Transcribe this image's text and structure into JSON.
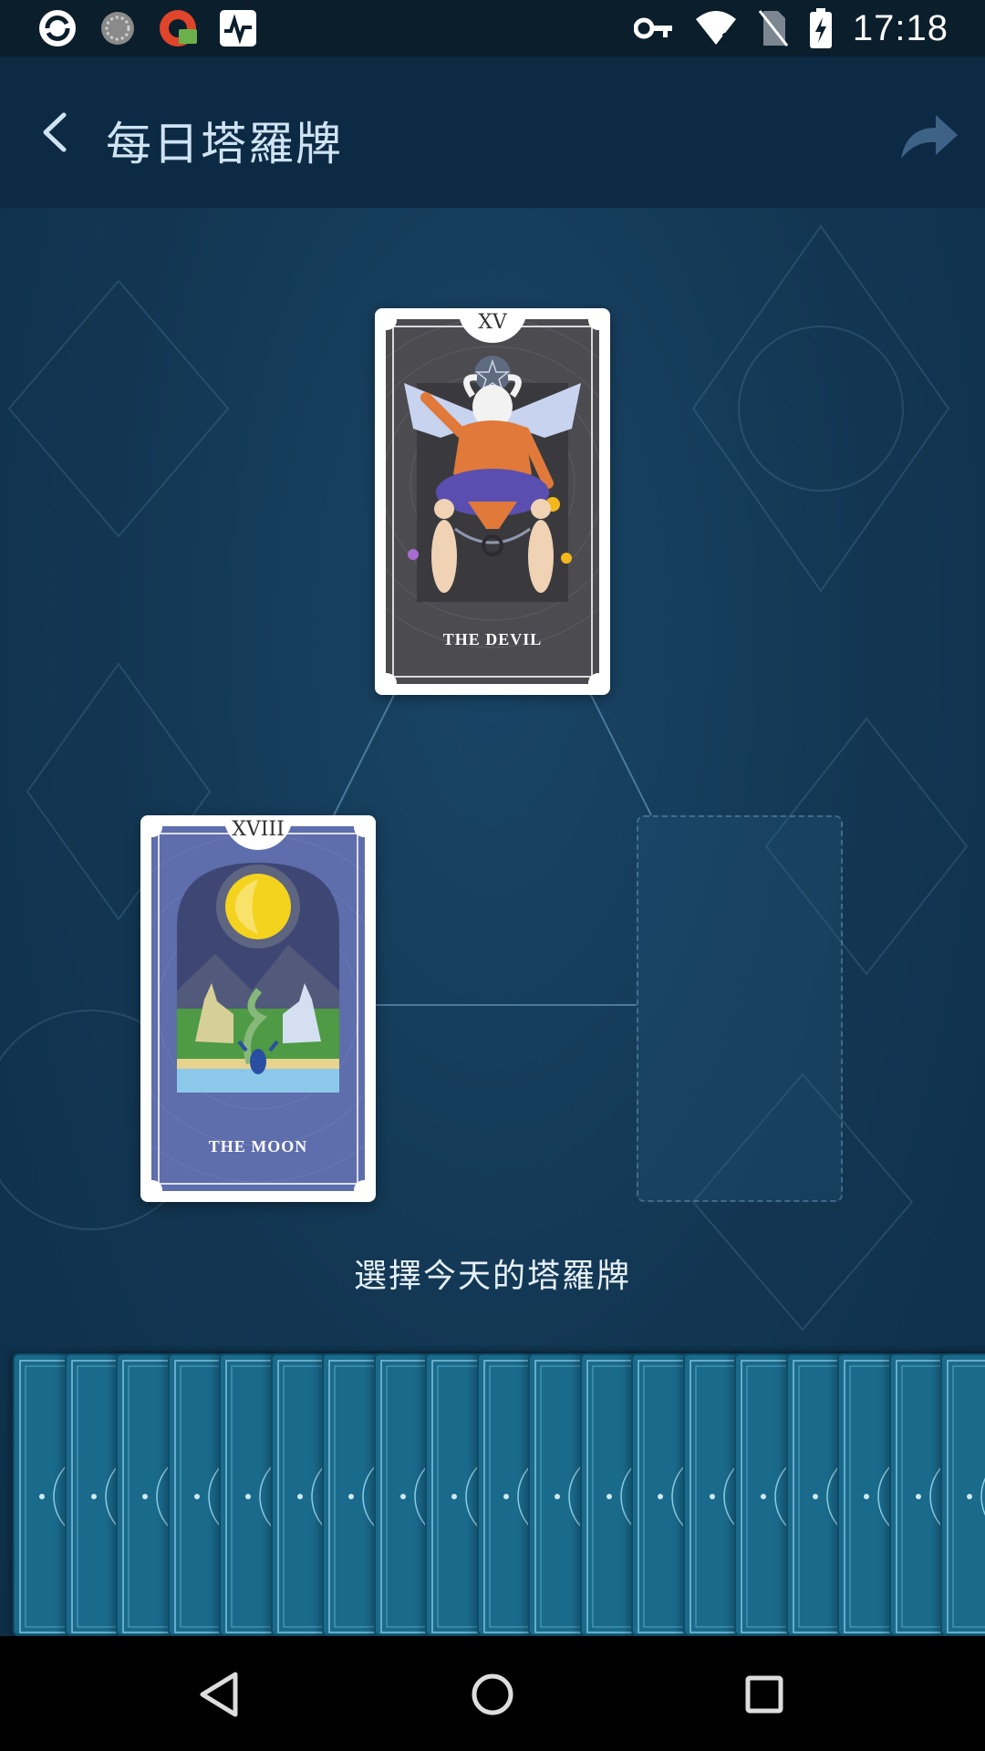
{
  "status_bar": {
    "time": "17:18",
    "left_icons": [
      "sync-app-icon",
      "loading-circle-icon",
      "vpn-app-icon",
      "activity-graph-icon"
    ],
    "right_icons": [
      "key-icon",
      "wifi-icon",
      "no-sim-icon",
      "battery-charging-icon"
    ]
  },
  "app_bar": {
    "title": "每日塔羅牌",
    "back_icon": "chevron-left-icon",
    "share_icon": "share-arrow-icon"
  },
  "spread": {
    "cards": [
      {
        "numeral": "XV",
        "name": "THE DEVIL",
        "position": "top"
      },
      {
        "numeral": "XVIII",
        "name": "THE MOON",
        "position": "bottom-left"
      }
    ],
    "empty_slot": "bottom-right"
  },
  "instruction": "選擇今天的塔羅牌",
  "deck": {
    "card_count": 19
  },
  "nav_bar": {
    "back_icon": "triangle-back-icon",
    "home_icon": "circle-home-icon",
    "recents_icon": "square-recents-icon"
  },
  "colors": {
    "app_bar": "#0d2a45",
    "status_bar": "#0b1e2c",
    "background": "#123652",
    "deck_card": "#1a6a8c"
  }
}
